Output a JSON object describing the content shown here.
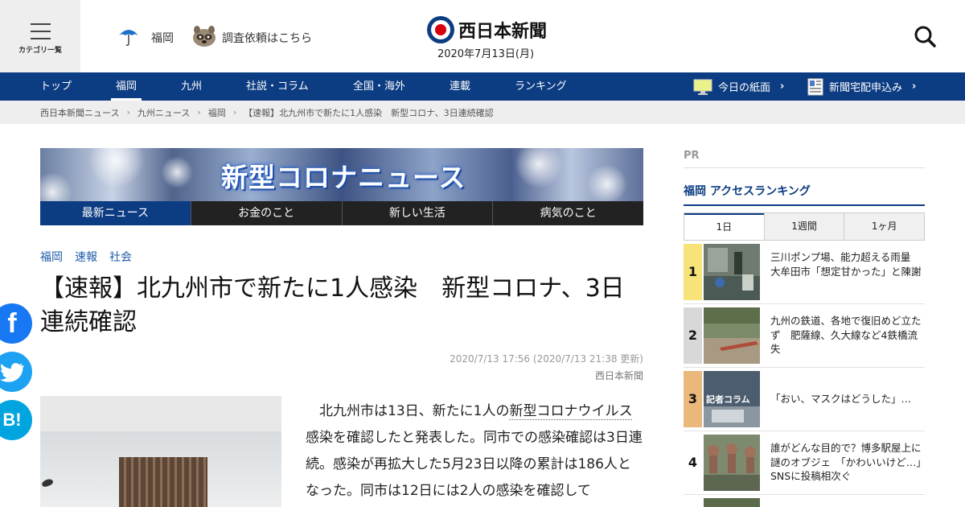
{
  "header": {
    "category_label": "カテゴリ一覧",
    "location_label": "福岡",
    "request_label": "調査依頼はこちら",
    "logo_text": "西日本新聞",
    "date": "2020年7月13日(月)"
  },
  "nav": {
    "items": [
      "トップ",
      "福岡",
      "九州",
      "社説・コラム",
      "全国・海外",
      "連載",
      "ランキング"
    ],
    "active": "福岡",
    "paper_label": "今日の紙面",
    "delivery_label": "新聞宅配申込み"
  },
  "breadcrumb": [
    "西日本新聞ニュース",
    "九州ニュース",
    "福岡",
    "【速報】北九州市で新たに1人感染　新型コロナ、3日連続確認"
  ],
  "banner": {
    "title": "新型コロナニュース",
    "tabs": [
      "最新ニュース",
      "お金のこと",
      "新しい生活",
      "病気のこと"
    ]
  },
  "article": {
    "tags": [
      "福岡",
      "速報",
      "社会"
    ],
    "headline": "【速報】北九州市で新たに1人感染　新型コロナ、3日連続確認",
    "timestamp": "2020/7/13 17:56 (2020/7/13 21:38 更新)",
    "source": "西日本新聞",
    "body_pre": "北九州市は13日、新たに1人の",
    "body_link": "新型コロナウイルス",
    "body_post": "感染を確認したと発表した。同市での感染確認は3日連続。感染が再拡大した5月23日以降の累計は186人となった。同市は12日には2人の感染を確認して"
  },
  "social": {
    "facebook": "f",
    "hatena": "B!"
  },
  "sidebar": {
    "pr_label": "PR",
    "ranking_title": "福岡 アクセスランキング",
    "tabs": [
      "1日",
      "1週間",
      "1ヶ月"
    ],
    "items": [
      {
        "rank": "1",
        "title": "三川ポンプ場、能力超える雨量　大牟田市「想定甘かった」と陳謝",
        "color": "#f8e27a"
      },
      {
        "rank": "2",
        "title": "九州の鉄道、各地で復旧めど立たず　肥薩線、久大線など4鉄橋流失",
        "color": "#d8d8d8"
      },
      {
        "rank": "3",
        "title": "「おい、マスクはどうした」…",
        "color": "#e9b87a"
      },
      {
        "rank": "4",
        "title": "誰がどんな目的で？博多駅屋上に謎のオブジェ　「かわいいけど…」SNSに投稿相次ぐ",
        "color": "#ffffff"
      }
    ],
    "thumb3_caption": "記者コラム"
  },
  "colors": {
    "brand_navy": "#0c3c82",
    "link_blue": "#1e5aa8",
    "logo_red": "#d7000f"
  }
}
